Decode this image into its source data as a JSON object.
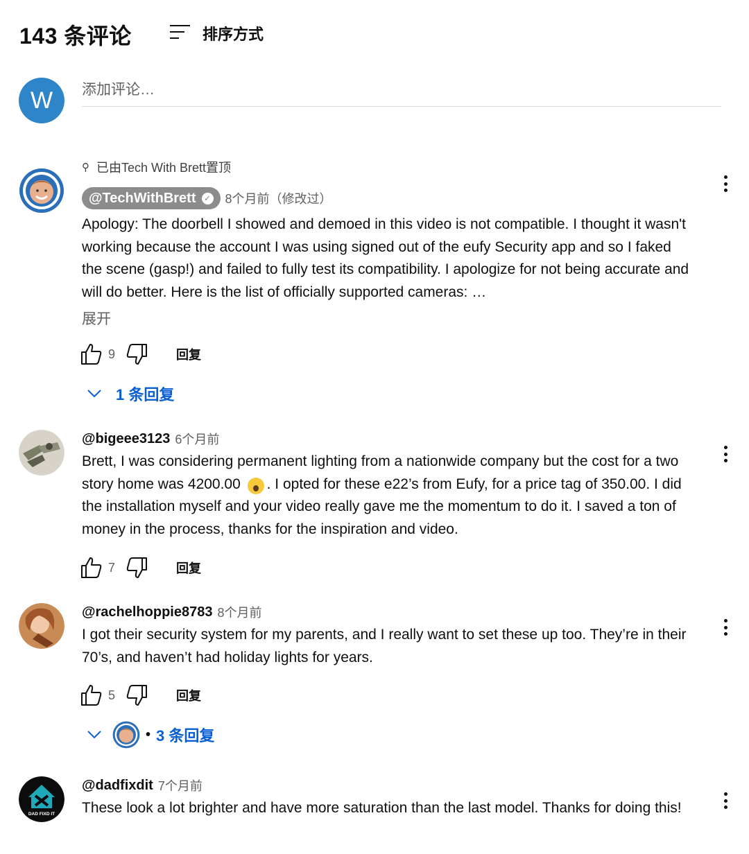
{
  "header": {
    "comment_count": "143 条评论",
    "sort_label": "排序方式"
  },
  "composer": {
    "avatar_letter": "W",
    "placeholder": "添加评论…"
  },
  "comments": [
    {
      "pinned_text": "已由Tech With Brett置顶",
      "handle": "@TechWithBrett",
      "time": "8个月前（修改过）",
      "text": "Apology: The doorbell I showed and demoed in this video is not compatible. I thought it wasn't working because the account I was using signed out of the eufy Security app and so I faked the scene (gasp!) and failed to fully test its compatibility. I apologize for not being accurate and will do better. Here is the list of officially supported cameras: …",
      "expand": "展开",
      "likes": "9",
      "reply_label": "回复",
      "replies_label": "1 条回复"
    },
    {
      "handle": "@bigeee3123",
      "time": "6个月前",
      "text_before_emoji": "Brett,  I was considering permanent lighting from a nationwide company but the cost for a two story home was 4200.00 ",
      "text_after_emoji": ".  I opted for these e22’s from Eufy, for a price tag of 350.00.  I did the installation myself and your video really gave me the momentum to do it. I saved a ton of money in the process, thanks for the inspiration and video.",
      "likes": "7",
      "reply_label": "回复"
    },
    {
      "handle": "@rachelhoppie8783",
      "time": "8个月前",
      "text": "I got their security system for my parents, and I really want to set these up too. They’re in their 70’s, and haven’t had holiday lights for years.",
      "likes": "5",
      "reply_label": "回复",
      "replies_label": "3 条回复"
    },
    {
      "handle": "@dadfixdit",
      "time": "7个月前",
      "avatar_text": "DAD FIXD IT",
      "text": "These look a lot brighter and have more saturation than the last model. Thanks for doing this!"
    }
  ]
}
